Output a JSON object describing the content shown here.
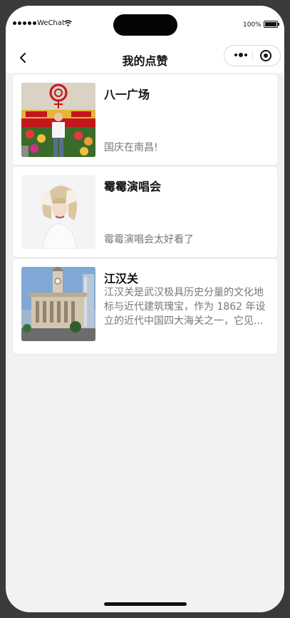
{
  "status_bar": {
    "carrier": "WeChat",
    "battery": "100%"
  },
  "navbar": {
    "title": "我的点赞"
  },
  "items": [
    {
      "title": "八一广场",
      "description": "国庆在南昌!"
    },
    {
      "title": "霉霉演唱会",
      "description": "霉霉演唱会太好看了"
    },
    {
      "title": "江汉关",
      "description": "江汉关是武汉极具历史分量的文化地标与近代建筑瑰宝，作为 1862 年设立的近代中国四大海关之一，它见..."
    }
  ],
  "colors": {
    "page_background": "#f2f2f2",
    "card_background": "#ffffff",
    "title_text": "#111111",
    "description_text": "#777777"
  },
  "icons": {
    "back": "chevron-left-icon",
    "more": "more-dots-icon",
    "close": "target-close-icon",
    "wifi": "wifi-icon",
    "battery": "battery-icon"
  }
}
